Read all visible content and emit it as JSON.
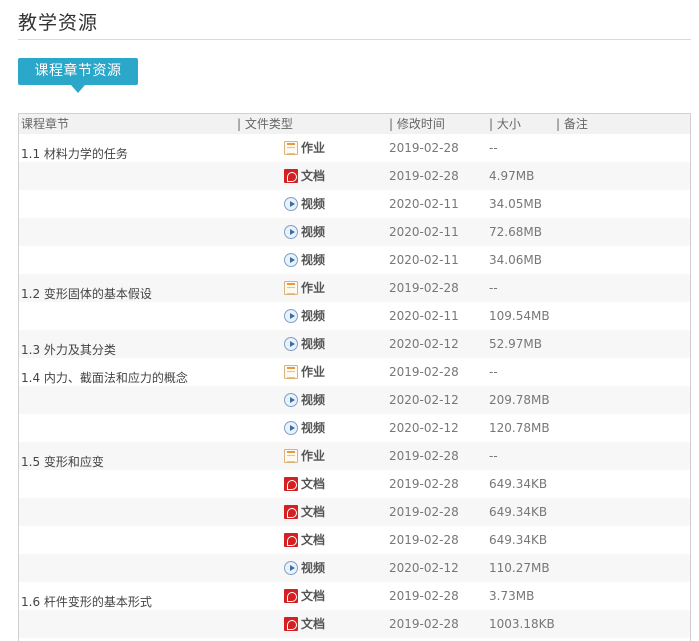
{
  "page": {
    "title": "教学资源"
  },
  "tab": {
    "label": "课程章节资源"
  },
  "table": {
    "headers": {
      "chapter": "课程章节",
      "type": "| 文件类型",
      "time": "| 修改时间",
      "size": "| 大小",
      "note": "| 备注"
    },
    "rows": [
      {
        "chapter": "1.1 材料力学的任务",
        "icon": "homework-icon",
        "type": "作业",
        "time": "2019-02-28",
        "size": "--"
      },
      {
        "chapter": "",
        "icon": "pdf-icon",
        "type": "文档",
        "time": "2019-02-28",
        "size": "4.97MB"
      },
      {
        "chapter": "",
        "icon": "video-icon",
        "type": "视频",
        "time": "2020-02-11",
        "size": "34.05MB"
      },
      {
        "chapter": "",
        "icon": "video-icon",
        "type": "视频",
        "time": "2020-02-11",
        "size": "72.68MB"
      },
      {
        "chapter": "",
        "icon": "video-icon",
        "type": "视频",
        "time": "2020-02-11",
        "size": "34.06MB"
      },
      {
        "chapter": "1.2 变形固体的基本假设",
        "icon": "homework-icon",
        "type": "作业",
        "time": "2019-02-28",
        "size": "--"
      },
      {
        "chapter": "",
        "icon": "video-icon",
        "type": "视频",
        "time": "2020-02-11",
        "size": "109.54MB"
      },
      {
        "chapter": "1.3 外力及其分类",
        "icon": "video-icon",
        "type": "视频",
        "time": "2020-02-12",
        "size": "52.97MB"
      },
      {
        "chapter": "1.4 内力、截面法和应力的概念",
        "icon": "homework-icon",
        "type": "作业",
        "time": "2019-02-28",
        "size": "--"
      },
      {
        "chapter": "",
        "icon": "video-icon",
        "type": "视频",
        "time": "2020-02-12",
        "size": "209.78MB"
      },
      {
        "chapter": "",
        "icon": "video-icon",
        "type": "视频",
        "time": "2020-02-12",
        "size": "120.78MB"
      },
      {
        "chapter": "1.5 变形和应变",
        "icon": "homework-icon",
        "type": "作业",
        "time": "2019-02-28",
        "size": "--"
      },
      {
        "chapter": "",
        "icon": "pdf-icon",
        "type": "文档",
        "time": "2019-02-28",
        "size": "649.34KB"
      },
      {
        "chapter": "",
        "icon": "pdf-icon",
        "type": "文档",
        "time": "2019-02-28",
        "size": "649.34KB"
      },
      {
        "chapter": "",
        "icon": "pdf-icon",
        "type": "文档",
        "time": "2019-02-28",
        "size": "649.34KB"
      },
      {
        "chapter": "",
        "icon": "video-icon",
        "type": "视频",
        "time": "2020-02-12",
        "size": "110.27MB"
      },
      {
        "chapter": "1.6 杆件变形的基本形式",
        "icon": "pdf-icon",
        "type": "文档",
        "time": "2019-02-28",
        "size": "3.73MB"
      },
      {
        "chapter": "",
        "icon": "pdf-icon",
        "type": "文档",
        "time": "2019-02-28",
        "size": "1003.18KB"
      }
    ]
  },
  "colors": {
    "accent": "#2aa7c9",
    "row_alt": "#f7f7f7",
    "header_bg": "#f2f2f2",
    "pdf_red": "#d42020"
  }
}
